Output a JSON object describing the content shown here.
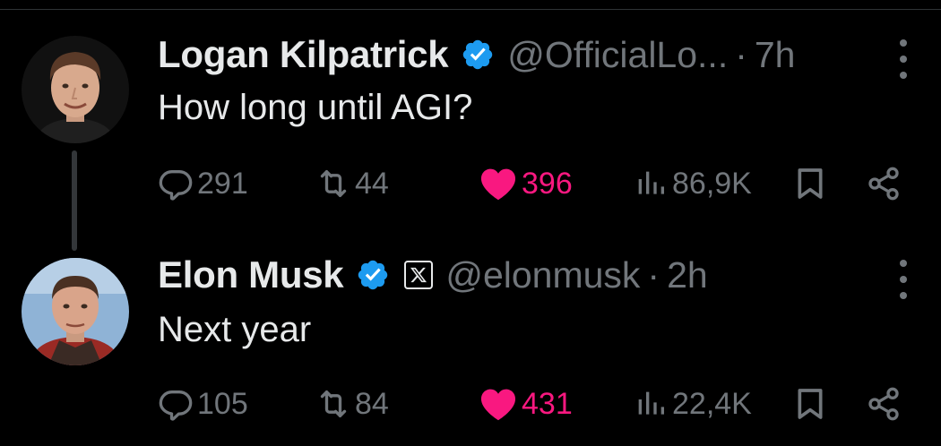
{
  "colors": {
    "background": "#000000",
    "text_primary": "#e7e9ea",
    "text_secondary": "#71767b",
    "verified_blue": "#1d9bf0",
    "like_pink": "#f91880"
  },
  "tweets": [
    {
      "author_name": "Logan Kilpatrick",
      "verified": true,
      "handle": "@OfficialLo...",
      "separator": "·",
      "time": "7h",
      "text": "How long until AGI?",
      "replies": "291",
      "reposts": "44",
      "likes": "396",
      "liked": true,
      "views": "86,9K"
    },
    {
      "author_name": "Elon Musk",
      "verified": true,
      "affiliate_badge": "x-logo-icon",
      "handle": "@elonmusk",
      "separator": "·",
      "time": "2h",
      "text": "Next year",
      "replies": "105",
      "reposts": "84",
      "likes": "431",
      "liked": true,
      "views": "22,4K"
    }
  ]
}
